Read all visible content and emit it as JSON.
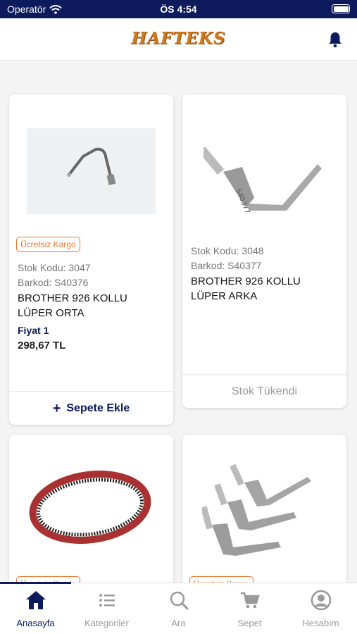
{
  "status_bar": {
    "carrier": "Operatör",
    "time": "ÖS 4:54"
  },
  "header": {
    "logo": "HAFTEKS"
  },
  "products": [
    {
      "badge": "Ücretsiz Kargo",
      "stock_code": "Stok Kodu: 3047",
      "barcode": "Barkod: S40376",
      "name": "BROTHER 926 KOLLU LÜPER ORTA",
      "price_label": "Fiyat 1",
      "price": "298,67 TL",
      "action": "Sepete Ekle"
    },
    {
      "stock_code": "Stok Kodu: 3048",
      "barcode": "Barkod: S40377",
      "name": "BROTHER 926 KOLLU LÜPER ARKA",
      "action": "Stok Tükendi"
    },
    {
      "badge": "Ücretsiz Kargo"
    },
    {
      "badge": "Ücretsiz Kargo"
    }
  ],
  "tabs": [
    {
      "label": "Anasayfa",
      "icon": "home-icon",
      "active": true
    },
    {
      "label": "Kategoriler",
      "icon": "list-icon"
    },
    {
      "label": "Ara",
      "icon": "search-icon"
    },
    {
      "label": "Sepet",
      "icon": "cart-icon"
    },
    {
      "label": "Hesabım",
      "icon": "account-icon"
    }
  ],
  "colors": {
    "primary": "#0d1a5c",
    "accent": "#e8742a",
    "logo": "#d07a1e"
  }
}
